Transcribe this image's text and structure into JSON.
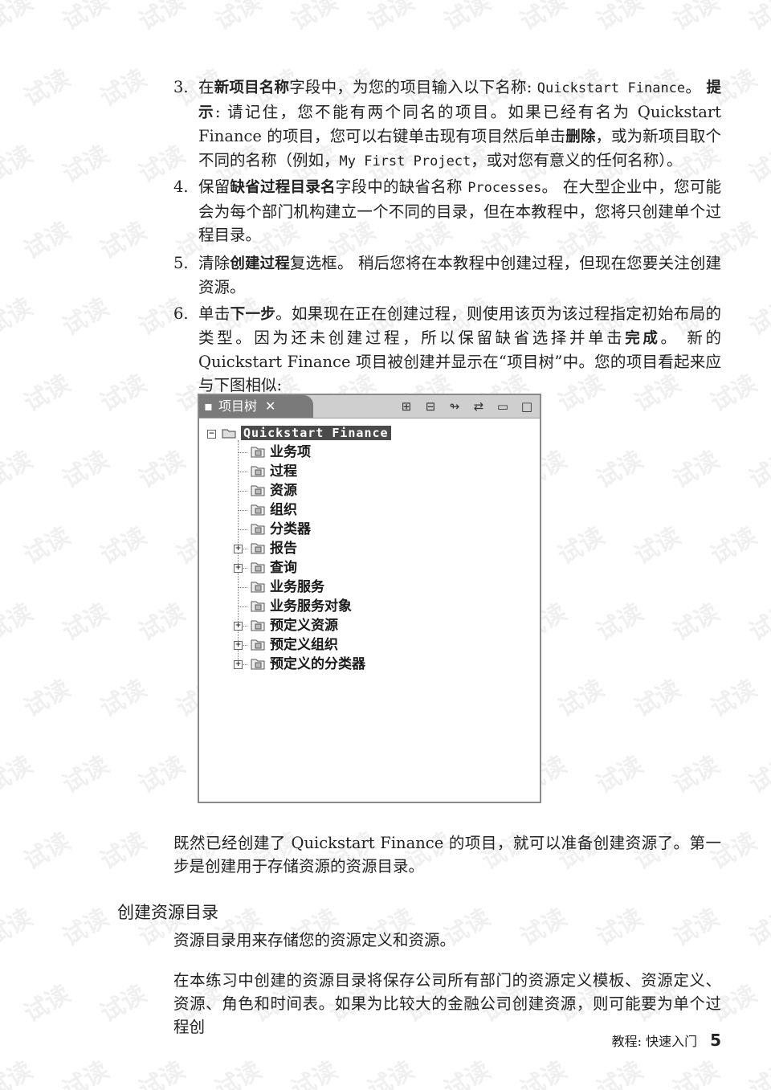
{
  "steps": [
    {
      "num": "3.",
      "parts": [
        {
          "t": "在"
        },
        {
          "t": "新项目名称",
          "s": "b"
        },
        {
          "t": "字段中，为您的项目输入以下名称: "
        },
        {
          "t": "Quickstart Finance",
          "s": "mono"
        },
        {
          "t": "。 "
        },
        {
          "t": "提示",
          "s": "b"
        },
        {
          "t": ": 请记住，您不能有两个同名的项目。如果已经有名为 Quickstart Finance 的项目，您可以右键单击现有项目然后单击"
        },
        {
          "t": "删除",
          "s": "b"
        },
        {
          "t": "，或为新项目取个不同的名称（例如，"
        },
        {
          "t": "My First Project",
          "s": "mono"
        },
        {
          "t": "，或对您有意义的任何名称）。"
        }
      ]
    },
    {
      "num": "4.",
      "parts": [
        {
          "t": "保留"
        },
        {
          "t": "缺省过程目录名",
          "s": "b"
        },
        {
          "t": "字段中的缺省名称 "
        },
        {
          "t": "Processes",
          "s": "mono"
        },
        {
          "t": "。 在大型企业中，您可能会为每个部门机构建立一个不同的目录，但在本教程中，您将只创建单个过程目录。"
        }
      ]
    },
    {
      "num": "5.",
      "parts": [
        {
          "t": "清除"
        },
        {
          "t": "创建过程",
          "s": "b"
        },
        {
          "t": "复选框。 稍后您将在本教程中创建过程，但现在您要关注创建资源。"
        }
      ]
    },
    {
      "num": "6.",
      "parts": [
        {
          "t": "单击"
        },
        {
          "t": "下一步",
          "s": "b"
        },
        {
          "t": "。如果现在正在创建过程，则使用该页为该过程指定初始布局的类型。因为还未创建过程，所以保留缺省选择并单击"
        },
        {
          "t": "完成",
          "s": "b"
        },
        {
          "t": "。 新的 Quickstart Finance 项目被创建并显示在“项目树”中。您的项目看起来应与下图相似:"
        }
      ]
    }
  ],
  "panel": {
    "tab_label": "项目树",
    "close_glyph": "✕",
    "toolbar_icons": [
      "expand-all-icon",
      "collapse-all-icon",
      "link-icon",
      "filter-icon",
      "minimize-icon",
      "maximize-icon"
    ],
    "toolbar_glyphs": [
      "⊞",
      "⊟",
      "↬",
      "⇄",
      "▭",
      "□"
    ],
    "root": "Quickstart Finance",
    "items": [
      {
        "label": "业务项",
        "expandable": false,
        "icon": "business-item-icon"
      },
      {
        "label": "过程",
        "expandable": false,
        "icon": "process-icon"
      },
      {
        "label": "资源",
        "expandable": false,
        "icon": "resource-icon"
      },
      {
        "label": "组织",
        "expandable": false,
        "icon": "organization-icon"
      },
      {
        "label": "分类器",
        "expandable": false,
        "icon": "classifier-icon"
      },
      {
        "label": "报告",
        "expandable": true,
        "icon": "report-icon"
      },
      {
        "label": "查询",
        "expandable": true,
        "icon": "query-icon"
      },
      {
        "label": "业务服务",
        "expandable": false,
        "icon": "business-service-icon"
      },
      {
        "label": "业务服务对象",
        "expandable": false,
        "icon": "business-service-object-icon"
      },
      {
        "label": "预定义资源",
        "expandable": true,
        "icon": "predefined-resource-icon"
      },
      {
        "label": "预定义组织",
        "expandable": true,
        "icon": "predefined-organization-icon"
      },
      {
        "label": "预定义的分类器",
        "expandable": true,
        "icon": "predefined-classifier-icon"
      }
    ]
  },
  "after_figure": "既然已经创建了 Quickstart Finance 的项目，就可以准备创建资源了。第一步是创建用于存储资源的资源目录。",
  "section_heading": "创建资源目录",
  "section_para1": "资源目录用来存储您的资源定义和资源。",
  "section_para2": "在本练习中创建的资源目录将保存公司所有部门的资源定义模板、资源定义、资源、角色和时间表。如果为比较大的金融公司创建资源，则可能要为单个过程创",
  "footer": {
    "text": "教程: 快速入门",
    "page": "5"
  },
  "watermark_text": "试读"
}
